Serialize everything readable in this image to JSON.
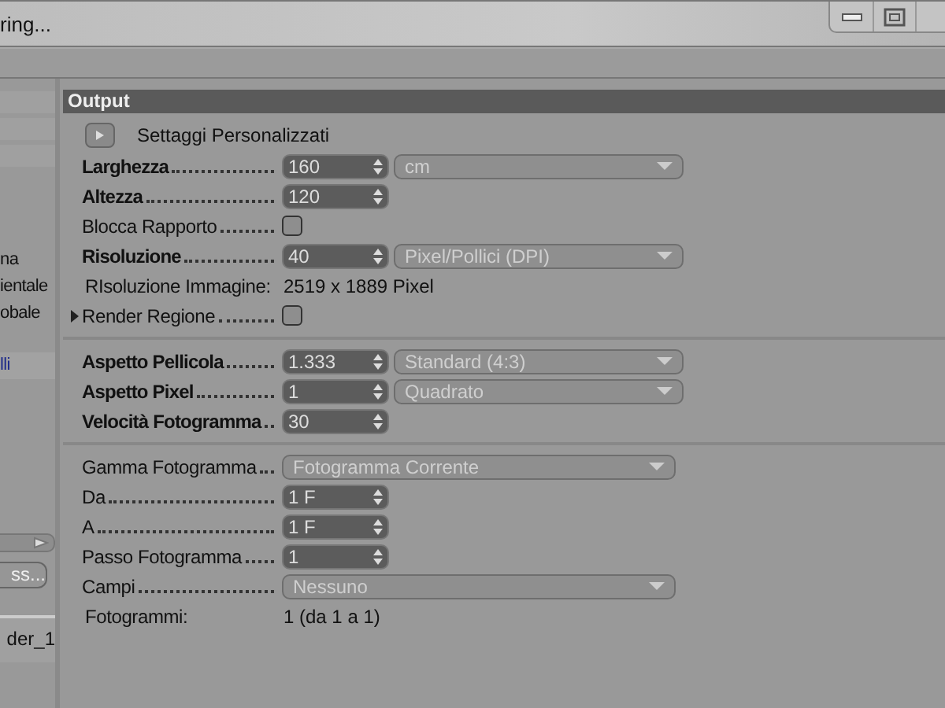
{
  "window": {
    "title": "ring..."
  },
  "sidebar": {
    "items": [
      {
        "label": "na",
        "selected": false
      },
      {
        "label": "ientale",
        "selected": false
      },
      {
        "label": "obale",
        "selected": false
      },
      {
        "label": "lli",
        "selected": true
      }
    ],
    "button": "ss...",
    "file": "der_1"
  },
  "panel": {
    "title": "Output",
    "preset": "Settaggi  Personalizzati",
    "groups": [
      [
        {
          "kind": "number",
          "label": "Larghezza",
          "bold": true,
          "value": "160",
          "unit": "cm"
        },
        {
          "kind": "number",
          "label": "Altezza",
          "bold": true,
          "value": "120"
        },
        {
          "kind": "checkbox",
          "label": "Blocca Rapporto",
          "bold": false,
          "checked": false
        },
        {
          "kind": "number",
          "label": "Risoluzione",
          "bold": true,
          "value": "40",
          "unit": "Pixel/Pollici (DPI)"
        },
        {
          "kind": "info",
          "label": "RIsoluzione Immagine:",
          "value": "2519 x 1889 Pixel"
        },
        {
          "kind": "checkbox",
          "label": "Render Regione",
          "bold": false,
          "checked": false,
          "expandable": true
        }
      ],
      [
        {
          "kind": "number",
          "label": "Aspetto Pellicola",
          "bold": true,
          "value": "1.333",
          "unit": "Standard (4:3)"
        },
        {
          "kind": "number",
          "label": "Aspetto Pixel",
          "bold": true,
          "value": "1",
          "unit": "Quadrato"
        },
        {
          "kind": "number",
          "label": "Velocità Fotogramma",
          "bold": true,
          "value": "30"
        }
      ],
      [
        {
          "kind": "select",
          "label": "Gamma Fotogramma",
          "bold": false,
          "value": "Fotogramma Corrente"
        },
        {
          "kind": "number",
          "label": "Da",
          "bold": false,
          "value": "1 F"
        },
        {
          "kind": "number",
          "label": "A",
          "bold": false,
          "value": "1 F"
        },
        {
          "kind": "number",
          "label": "Passo Fotogramma",
          "bold": false,
          "value": "1"
        },
        {
          "kind": "select",
          "label": "Campi",
          "bold": false,
          "value": "Nessuno"
        },
        {
          "kind": "info",
          "label": "Fotogrammi:",
          "value": "1 (da 1 a 1)"
        }
      ]
    ]
  }
}
